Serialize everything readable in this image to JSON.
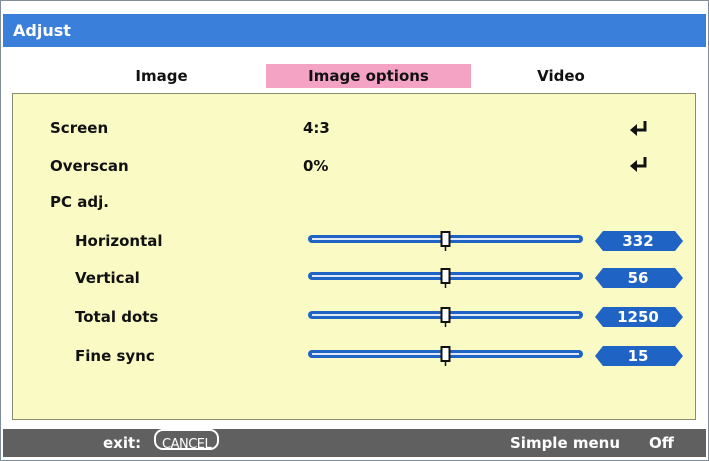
{
  "window": {
    "title": "Adjust"
  },
  "tabs": [
    {
      "label": "Image",
      "active": false
    },
    {
      "label": "Image options",
      "active": true
    },
    {
      "label": "Video",
      "active": false
    }
  ],
  "rows": {
    "screen": {
      "label": "Screen",
      "value": "4:3"
    },
    "overscan": {
      "label": "Overscan",
      "value": "0%"
    },
    "pc_adj": {
      "label": "PC adj."
    }
  },
  "sliders": [
    {
      "label": "Horizontal",
      "value": "332",
      "level": 0.5
    },
    {
      "label": "Vertical",
      "value": "56",
      "level": 0.5
    },
    {
      "label": "Total dots",
      "value": "1250",
      "level": 0.5
    },
    {
      "label": "Fine sync",
      "value": "15",
      "level": 0.5
    }
  ],
  "footer": {
    "exit_label": "exit:",
    "cancel_key": "CANCEL",
    "menu_mode_label": "Simple menu",
    "menu_mode_value": "Off"
  },
  "colors": {
    "title_bar": "#3a7fd9",
    "active_tab": "#f5a3c5",
    "panel": "#fafac5",
    "slider_blue": "#1f63c4",
    "footer": "#606060"
  },
  "icons": {
    "enter": "enter-return-icon"
  }
}
